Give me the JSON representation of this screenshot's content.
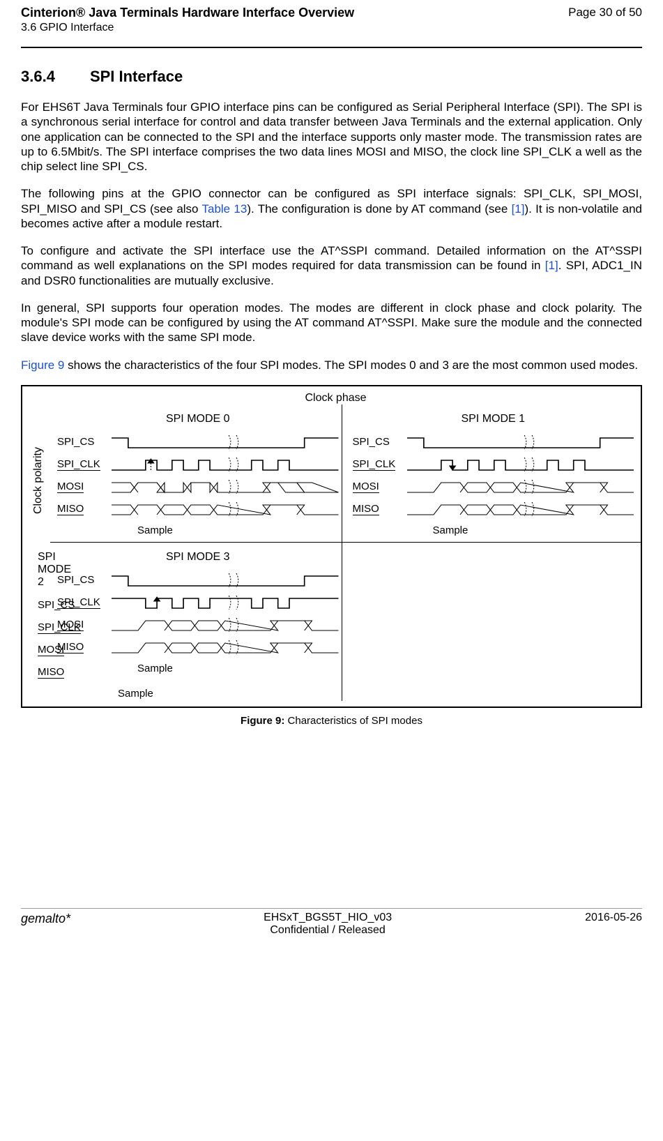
{
  "header": {
    "title": "Cinterion® Java Terminals Hardware Interface Overview",
    "page": "Page 30 of 50",
    "section_sub": "3.6 GPIO Interface"
  },
  "section": {
    "num": "3.6.4",
    "title": "SPI Interface"
  },
  "body": {
    "p1": "For EHS6T Java Terminals four GPIO interface pins can be configured as Serial Peripheral Interface (SPI). The SPI is a synchronous serial interface for control and data transfer between Java Terminals and the external application. Only one application can be connected to the SPI and the interface supports only master mode. The transmission rates are up to 6.5Mbit/s. The SPI interface comprises the two data lines MOSI and MISO, the clock line SPI_CLK a well as the chip select line SPI_CS.",
    "p2a": "The following pins at the GPIO connector can be configured as SPI interface signals: SPI_CLK, SPI_MOSI, SPI_MISO and SPI_CS (see also ",
    "p2_link1": "Table 13",
    "p2b": "). The configuration is done by AT command (see ",
    "p2_link2": "[1]",
    "p2c": "). It is non-volatile and becomes active after a module restart.",
    "p3a": "To configure and activate the SPI interface use the AT^SSPI command. Detailed information on the AT^SSPI command as well explanations on the SPI modes required for data transmission can be found in ",
    "p3_link": "[1]",
    "p3b": ". SPI, ADC1_IN and DSR0 functionalities are mutually exclusive.",
    "p4": "In general, SPI supports four operation modes. The modes are different in clock phase and clock polarity. The module's SPI mode can be configured by using the AT command AT^SSPI. Make sure the module and the connected slave device works with the same SPI mode.",
    "p5a": "Figure 9",
    "p5b": " shows the characteristics of the four SPI modes. The SPI modes 0 and 3 are the most common used modes."
  },
  "figure": {
    "clock_phase": "Clock phase",
    "clock_polarity": "Clock polarity",
    "modes": [
      "SPI MODE 0",
      "SPI MODE 1",
      "SPI MODE 2",
      "SPI MODE 3"
    ],
    "signals": [
      "SPI_CS",
      "SPI_CLK",
      "MOSI",
      "MISO"
    ],
    "sample": "Sample",
    "caption_bold": "Figure 9:",
    "caption_rest": "  Characteristics of SPI modes"
  },
  "footer": {
    "logo": "gemalto*",
    "doc": "EHSxT_BGS5T_HIO_v03",
    "conf": "Confidential / Released",
    "date": "2016-05-26"
  }
}
